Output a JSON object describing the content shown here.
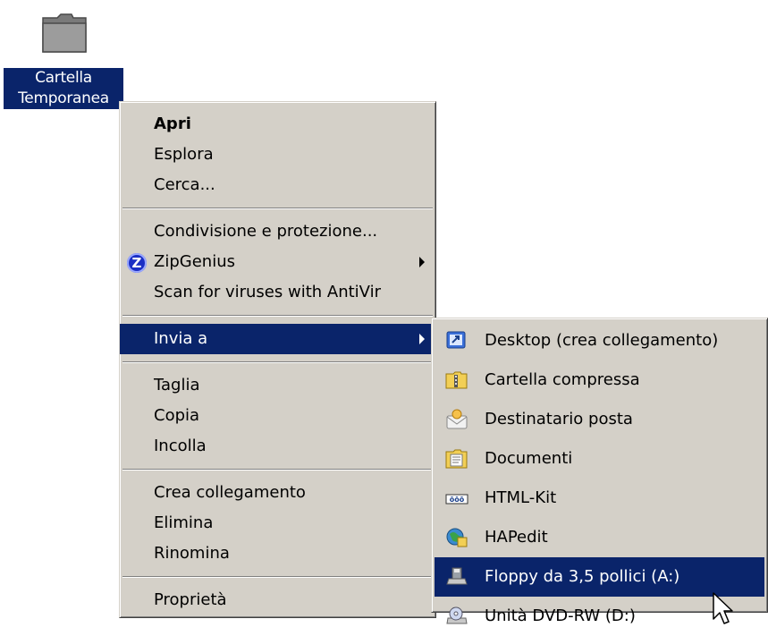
{
  "desktop_icon": {
    "label_line1": "Cartella",
    "label_line2": "Temporanea",
    "icon": "folder-icon"
  },
  "context_menu": {
    "items": [
      {
        "label": "Apri",
        "bold": true
      },
      {
        "label": "Esplora"
      },
      {
        "label": "Cerca..."
      },
      {
        "label": "Condivisione e protezione..."
      },
      {
        "label": "ZipGenius",
        "submenu": true,
        "icon": "zipgenius-icon"
      },
      {
        "label": "Scan for viruses with AntiVir"
      },
      {
        "label": "Invia a",
        "submenu": true,
        "selected": true
      },
      {
        "label": "Taglia"
      },
      {
        "label": "Copia"
      },
      {
        "label": "Incolla"
      },
      {
        "label": "Crea collegamento"
      },
      {
        "label": "Elimina"
      },
      {
        "label": "Rinomina"
      },
      {
        "label": "Proprietà"
      }
    ]
  },
  "send_to_menu": {
    "items": [
      {
        "label": "Desktop (crea collegamento)",
        "icon": "desktop-shortcut-icon"
      },
      {
        "label": "Cartella compressa",
        "icon": "zip-folder-icon"
      },
      {
        "label": "Destinatario posta",
        "icon": "mail-recipient-icon"
      },
      {
        "label": "Documenti",
        "icon": "documents-icon"
      },
      {
        "label": "HTML-Kit",
        "icon": "html-kit-icon"
      },
      {
        "label": "HAPedit",
        "icon": "hapedit-icon"
      },
      {
        "label": "Floppy da 3,5 pollici (A:)",
        "icon": "floppy-drive-icon",
        "selected": true
      },
      {
        "label": "Unità DVD-RW (D:)",
        "icon": "dvd-drive-icon"
      }
    ]
  },
  "colors": {
    "menu_bg": "#d4d0c8",
    "selection": "#0a246a",
    "desktop": "#ffffff"
  }
}
